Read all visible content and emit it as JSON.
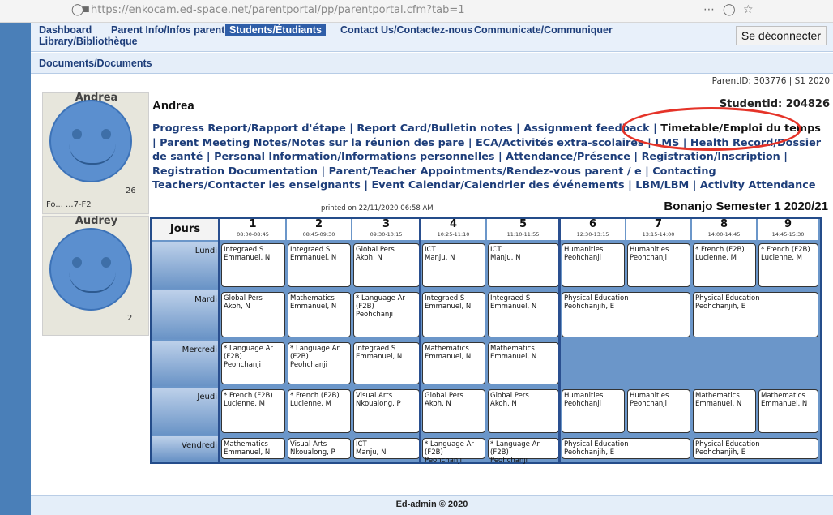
{
  "browser": {
    "url": "https://enkocam.ed-space.net/parentportal/pp/parentportal.cfm?tab=1"
  },
  "nav": {
    "items": [
      {
        "line1": "Dashboard",
        "line2": "Library/Bibliothèque"
      },
      {
        "line1": "Parent Info/Infos parent"
      },
      {
        "line1": "Students/Étudiants",
        "active": true
      },
      {
        "line1": "Contact Us/Contactez-nous"
      },
      {
        "line1": "Communicate/Communiquer"
      }
    ],
    "logout": "Se déconnecter",
    "secondary": "Documents/Documents"
  },
  "header": {
    "parent_id": "ParentID: 303776 | S1 2020"
  },
  "students": [
    {
      "name": "Andrea",
      "form_text": "Fo... ...7-F2",
      "id_fragment": "26"
    },
    {
      "name": "Audrey",
      "form_text": "2"
    }
  ],
  "student": {
    "name": "Andrea",
    "id_label": "Studentid: 204826"
  },
  "links": [
    {
      "label": "Progress Report/Rapport d'étape"
    },
    {
      "label": "Report Card/Bulletin notes"
    },
    {
      "label": "Assignment feedback"
    },
    {
      "label": "Timetable/Emploi du temps",
      "highlighted": true
    },
    {
      "label": "Parent Meeting Notes/Notes sur la réunion des pare"
    },
    {
      "label": "ECA/Activités extra-scolaires"
    },
    {
      "label": "LMS"
    },
    {
      "label": "Health Record/Dossier de santé"
    },
    {
      "label": "Personal Information/Informations personnelles"
    },
    {
      "label": "Attendance/Présence"
    },
    {
      "label": "Registration/Inscription"
    },
    {
      "label": "Registration Documentation"
    },
    {
      "label": "Parent/Teacher Appointments/Rendez-vous parent / e"
    },
    {
      "label": "Contacting Teachers/Contacter les enseignants"
    },
    {
      "label": "Event Calendar/Calendrier des événements"
    },
    {
      "label": "LBM/LBM"
    },
    {
      "label": "Activity Attendance"
    }
  ],
  "timetable": {
    "printed": "printed on 22/11/2020 06:58 AM",
    "semester": "Bonanjo Semester 1 2020/21",
    "jours_label": "Jours",
    "periods": [
      {
        "n": "1",
        "time": "08:00-08:45"
      },
      {
        "n": "2",
        "time": "08:45-09:30"
      },
      {
        "n": "3",
        "time": "09:30-10:15"
      },
      {
        "n": "4",
        "time": "10:25-11:10"
      },
      {
        "n": "5",
        "time": "11:10-11:55"
      },
      {
        "n": "6",
        "time": "12:30-13:15"
      },
      {
        "n": "7",
        "time": "13:15-14:00"
      },
      {
        "n": "8",
        "time": "14:00-14:45"
      },
      {
        "n": "9",
        "time": "14:45-15:30"
      }
    ],
    "days": [
      {
        "name": "Lundi",
        "cells": [
          {
            "p": 1,
            "span": 1,
            "lines": [
              "Integraed S",
              "Emmanuel, N"
            ]
          },
          {
            "p": 2,
            "span": 1,
            "lines": [
              "Integraed S",
              "Emmanuel, N"
            ]
          },
          {
            "p": 3,
            "span": 1,
            "lines": [
              "Global Pers",
              "Akoh, N"
            ]
          },
          {
            "p": 4,
            "span": 1,
            "lines": [
              "ICT",
              "Manju, N"
            ]
          },
          {
            "p": 5,
            "span": 1,
            "lines": [
              "ICT",
              "Manju, N"
            ]
          },
          {
            "p": 6,
            "span": 1,
            "lines": [
              "Humanities",
              "Peohchanji"
            ]
          },
          {
            "p": 7,
            "span": 1,
            "lines": [
              "Humanities",
              "Peohchanji"
            ]
          },
          {
            "p": 8,
            "span": 1,
            "lines": [
              "* French (F2B)",
              "Lucienne, M"
            ]
          },
          {
            "p": 9,
            "span": 1,
            "lines": [
              "* French (F2B)",
              "Lucienne, M"
            ]
          }
        ]
      },
      {
        "name": "Mardi",
        "cells": [
          {
            "p": 1,
            "span": 1,
            "lines": [
              "Global Pers",
              "Akoh, N"
            ]
          },
          {
            "p": 2,
            "span": 1,
            "lines": [
              "Mathematics",
              "Emmanuel, N"
            ]
          },
          {
            "p": 3,
            "span": 1,
            "lines": [
              "* Language Ar",
              "(F2B)",
              "Peohchanji"
            ]
          },
          {
            "p": 4,
            "span": 1,
            "lines": [
              "Integraed S",
              "Emmanuel, N"
            ]
          },
          {
            "p": 5,
            "span": 1,
            "lines": [
              "Integraed S",
              "Emmanuel, N"
            ]
          },
          {
            "p": 6,
            "span": 2,
            "lines": [
              "Physical Education",
              "Peohchanjih, E"
            ]
          },
          {
            "p": 8,
            "span": 2,
            "lines": [
              "Physical Education",
              "Peohchanjih, E"
            ]
          }
        ]
      },
      {
        "name": "Mercredi",
        "cells": [
          {
            "p": 1,
            "span": 1,
            "lines": [
              "* Language Ar",
              "(F2B)",
              "Peohchanji"
            ]
          },
          {
            "p": 2,
            "span": 1,
            "lines": [
              "* Language Ar",
              "(F2B)",
              "Peohchanji"
            ]
          },
          {
            "p": 3,
            "span": 1,
            "lines": [
              "Integraed S",
              "Emmanuel, N"
            ]
          },
          {
            "p": 4,
            "span": 1,
            "lines": [
              "Mathematics",
              "Emmanuel, N"
            ]
          },
          {
            "p": 5,
            "span": 1,
            "lines": [
              "Mathematics",
              "Emmanuel, N"
            ]
          }
        ]
      },
      {
        "name": "Jeudi",
        "cells": [
          {
            "p": 1,
            "span": 1,
            "lines": [
              "* French (F2B)",
              "Lucienne, M"
            ]
          },
          {
            "p": 2,
            "span": 1,
            "lines": [
              "* French (F2B)",
              "Lucienne, M"
            ]
          },
          {
            "p": 3,
            "span": 1,
            "lines": [
              "Visual Arts",
              "Nkoualong, P"
            ]
          },
          {
            "p": 4,
            "span": 1,
            "lines": [
              "Global Pers",
              "Akoh, N"
            ]
          },
          {
            "p": 5,
            "span": 1,
            "lines": [
              "Global Pers",
              "Akoh, N"
            ]
          },
          {
            "p": 6,
            "span": 1,
            "lines": [
              "Humanities",
              "Peohchanji"
            ]
          },
          {
            "p": 7,
            "span": 1,
            "lines": [
              "Humanities",
              "Peohchanji"
            ]
          },
          {
            "p": 8,
            "span": 1,
            "lines": [
              "Mathematics",
              "Emmanuel, N"
            ]
          },
          {
            "p": 9,
            "span": 1,
            "lines": [
              "Mathematics",
              "Emmanuel, N"
            ]
          }
        ]
      },
      {
        "name": "Vendredi",
        "cells": [
          {
            "p": 1,
            "span": 1,
            "lines": [
              "Mathematics",
              "Emmanuel, N"
            ]
          },
          {
            "p": 2,
            "span": 1,
            "lines": [
              "Visual Arts",
              "Nkoualong, P"
            ]
          },
          {
            "p": 3,
            "span": 1,
            "lines": [
              "ICT",
              "Manju, N"
            ]
          },
          {
            "p": 4,
            "span": 1,
            "lines": [
              "* Language Ar",
              "(F2B)",
              "Peohchanji"
            ]
          },
          {
            "p": 5,
            "span": 1,
            "lines": [
              "* Language Ar",
              "(F2B)",
              "Peohchanji"
            ]
          },
          {
            "p": 6,
            "span": 2,
            "lines": [
              "Physical Education",
              "Peohchanjih, E"
            ]
          },
          {
            "p": 8,
            "span": 2,
            "lines": [
              "Physical Education",
              "Peohchanjih, E"
            ]
          }
        ]
      }
    ]
  },
  "footer": "Ed-admin © 2020",
  "colors": {
    "nav_text": "#1e3e7a",
    "active_tab": "#2f5ea8",
    "annotation": "#e53328",
    "grid_bg": "#6b96c9"
  }
}
